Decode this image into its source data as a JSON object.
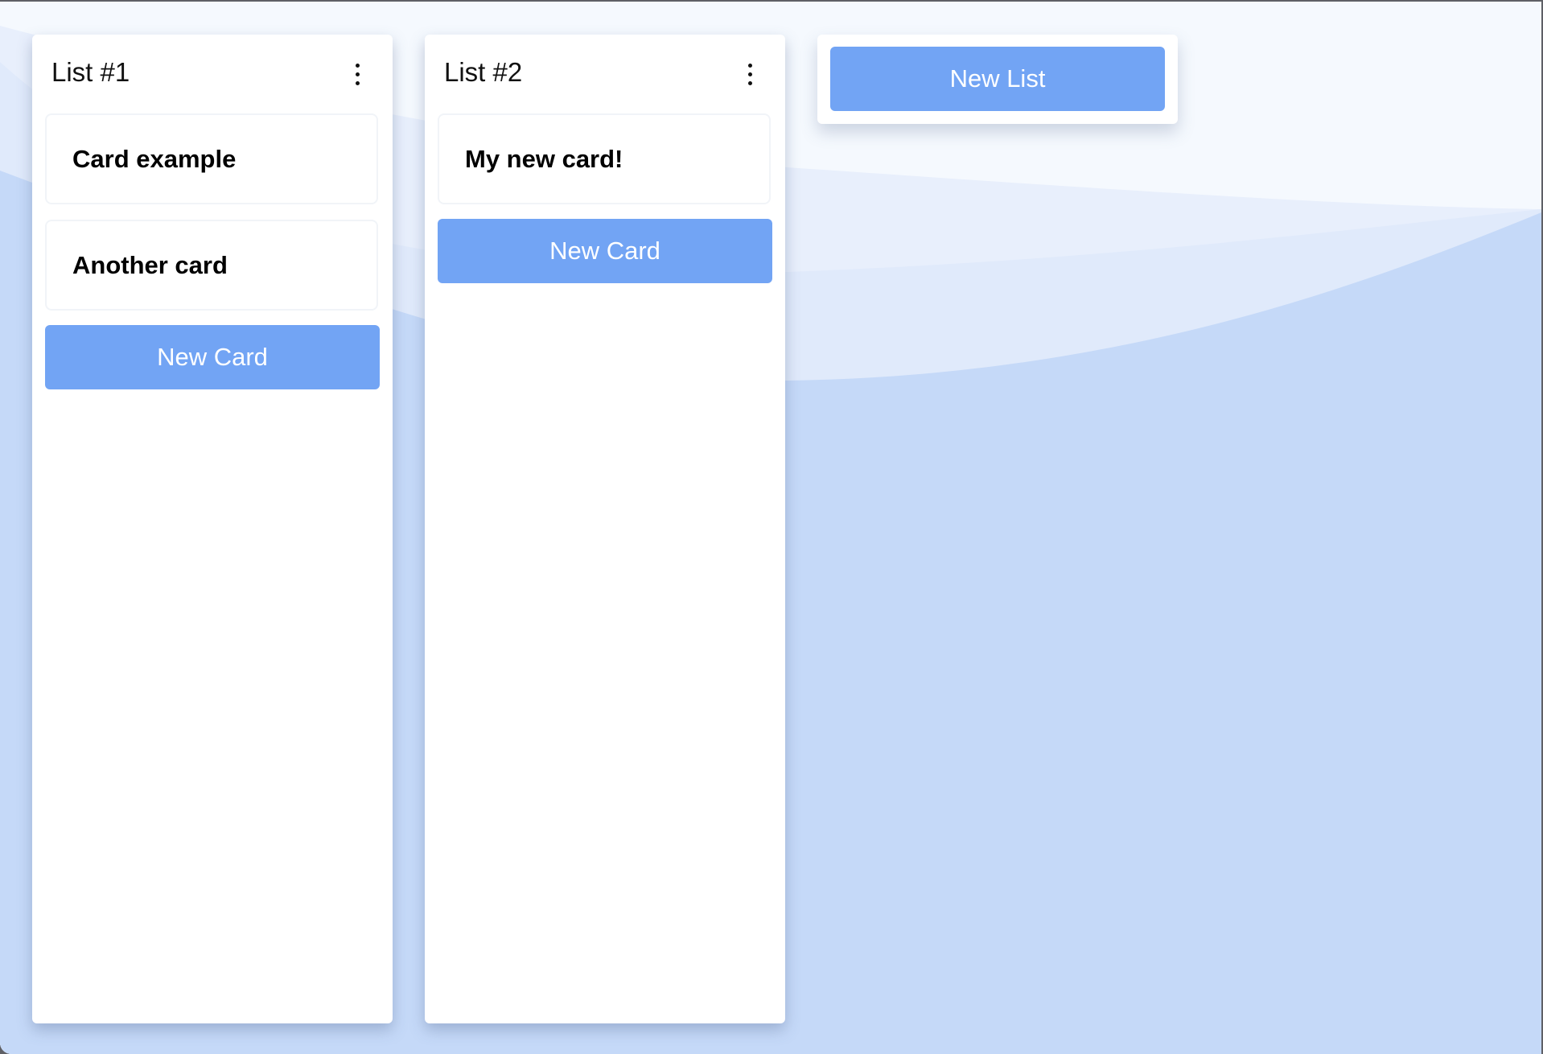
{
  "lists": [
    {
      "title": "List #1",
      "cards": [
        "Card example",
        "Another card"
      ],
      "new_card_label": "New Card"
    },
    {
      "title": "List #2",
      "cards": [
        "My new card!"
      ],
      "new_card_label": "New Card"
    }
  ],
  "new_list_label": "New List",
  "colors": {
    "accent": "#72a4f4",
    "background": "#c5d9f8"
  }
}
